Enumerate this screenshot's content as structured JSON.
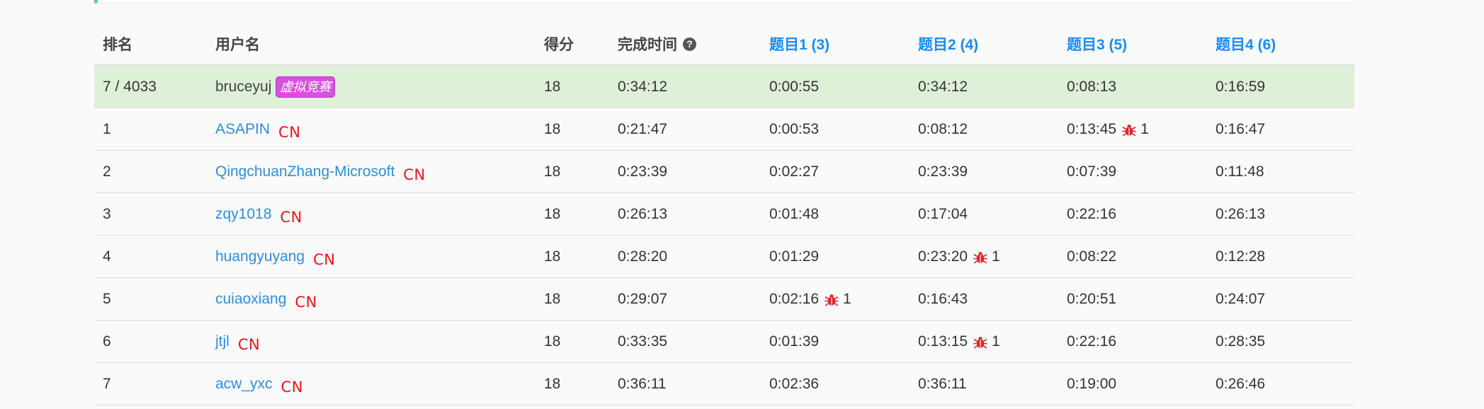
{
  "header": {
    "rank": "排名",
    "user": "用户名",
    "score": "得分",
    "time": "完成时间",
    "q1": "题目1 (3)",
    "q2": "题目2 (4)",
    "q3": "题目3 (5)",
    "q4": "题目4 (6)"
  },
  "colors": {
    "accent_link": "#2f8ddb",
    "highlight_row": "#dff0d8",
    "cn_red": "#e8141e",
    "badge": "#d94fe0"
  },
  "me": {
    "rank": "7 / 4033",
    "user": "bruceyuj",
    "badge": "虚拟竞赛",
    "score": "18",
    "time": "0:34:12",
    "q1": "0:00:55",
    "q2": "0:34:12",
    "q3": "0:08:13",
    "q4": "0:16:59"
  },
  "rows": [
    {
      "rank": "1",
      "user": "ASAPIN",
      "region": "CN",
      "score": "18",
      "time": "0:21:47",
      "q1": "0:00:53",
      "q1_wrong": "",
      "q2": "0:08:12",
      "q2_wrong": "",
      "q3": "0:13:45",
      "q3_wrong": "1",
      "q4": "0:16:47",
      "q4_wrong": ""
    },
    {
      "rank": "2",
      "user": "QingchuanZhang-Microsoft",
      "region": "CN",
      "score": "18",
      "time": "0:23:39",
      "q1": "0:02:27",
      "q1_wrong": "",
      "q2": "0:23:39",
      "q2_wrong": "",
      "q3": "0:07:39",
      "q3_wrong": "",
      "q4": "0:11:48",
      "q4_wrong": ""
    },
    {
      "rank": "3",
      "user": "zqy1018",
      "region": "CN",
      "score": "18",
      "time": "0:26:13",
      "q1": "0:01:48",
      "q1_wrong": "",
      "q2": "0:17:04",
      "q2_wrong": "",
      "q3": "0:22:16",
      "q3_wrong": "",
      "q4": "0:26:13",
      "q4_wrong": ""
    },
    {
      "rank": "4",
      "user": "huangyuyang",
      "region": "CN",
      "score": "18",
      "time": "0:28:20",
      "q1": "0:01:29",
      "q1_wrong": "",
      "q2": "0:23:20",
      "q2_wrong": "1",
      "q3": "0:08:22",
      "q3_wrong": "",
      "q4": "0:12:28",
      "q4_wrong": ""
    },
    {
      "rank": "5",
      "user": "cuiaoxiang",
      "region": "CN",
      "score": "18",
      "time": "0:29:07",
      "q1": "0:02:16",
      "q1_wrong": "1",
      "q2": "0:16:43",
      "q2_wrong": "",
      "q3": "0:20:51",
      "q3_wrong": "",
      "q4": "0:24:07",
      "q4_wrong": ""
    },
    {
      "rank": "6",
      "user": "jtjl",
      "region": "CN",
      "score": "18",
      "time": "0:33:35",
      "q1": "0:01:39",
      "q1_wrong": "",
      "q2": "0:13:15",
      "q2_wrong": "1",
      "q3": "0:22:16",
      "q3_wrong": "",
      "q4": "0:28:35",
      "q4_wrong": ""
    },
    {
      "rank": "7",
      "user": "acw_yxc",
      "region": "CN",
      "score": "18",
      "time": "0:36:11",
      "q1": "0:02:36",
      "q1_wrong": "",
      "q2": "0:36:11",
      "q2_wrong": "",
      "q3": "0:19:00",
      "q3_wrong": "",
      "q4": "0:26:46",
      "q4_wrong": ""
    }
  ]
}
